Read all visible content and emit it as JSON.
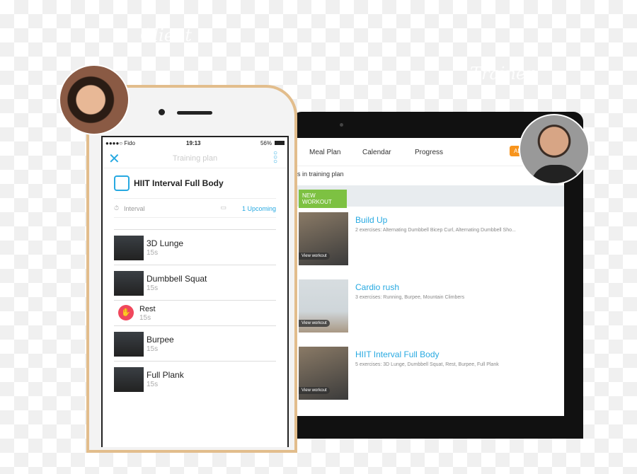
{
  "background_labels": {
    "client": "Client",
    "trainer": "Trainer"
  },
  "phone": {
    "status": {
      "carrier": "●●●●○ Fido",
      "time": "19:13",
      "battery": "56%"
    },
    "header": {
      "title": "Training plan"
    },
    "workout": {
      "name": "HIIT Interval Full Body",
      "type": "Interval",
      "upcoming": "1 Upcoming"
    },
    "exercises": [
      {
        "name": "3D Lunge",
        "duration": "15s"
      },
      {
        "name": "Dumbbell Squat",
        "duration": "15s"
      },
      {
        "name": "Rest",
        "duration": "15s"
      },
      {
        "name": "Burpee",
        "duration": "15s"
      },
      {
        "name": "Full Plank",
        "duration": "15s"
      }
    ]
  },
  "tablet": {
    "nav": [
      "Meal Plan",
      "Calendar",
      "Progress"
    ],
    "add_label": "AD",
    "subtitle": "s in training plan",
    "new_workout": "NEW WORKOUT",
    "view_workout": "View workout",
    "workouts": [
      {
        "title": "Build Up",
        "desc": "2 exercises: Alternating Dumbbell Bicep Curl, Alternating Dumbbell Sho..."
      },
      {
        "title": "Cardio rush",
        "desc": "3 exercises: Running, Burpee, Mountain Climbers"
      },
      {
        "title": "HIIT Interval Full Body",
        "desc": "5 exercises: 3D Lunge, Dumbbell Squat, Rest, Burpee, Full Plank"
      }
    ]
  },
  "colors": {
    "accent": "#27a9e1",
    "green": "#7dc142",
    "orange": "#f7941d",
    "rest": "#f0475c",
    "gold": "#e2bd8c"
  }
}
